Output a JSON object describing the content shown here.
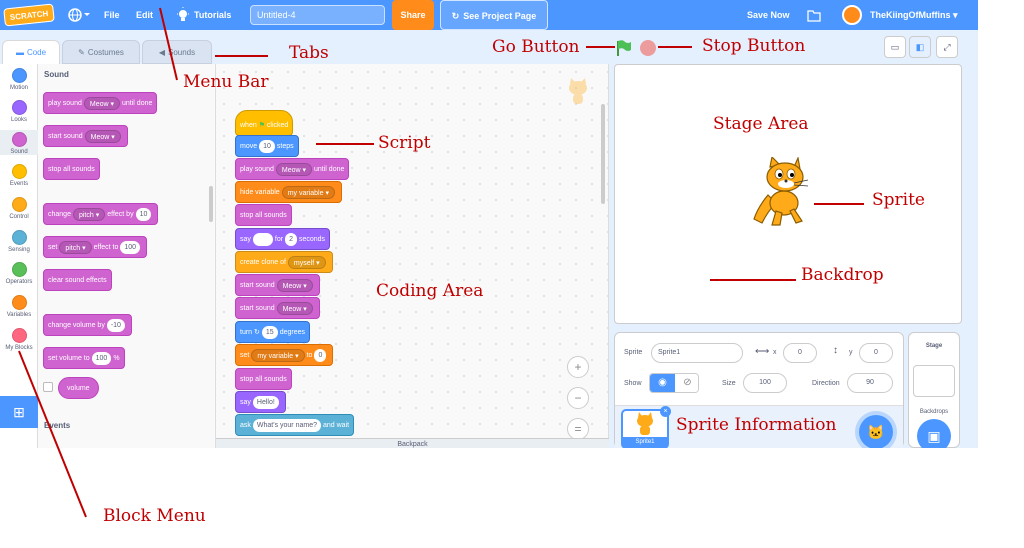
{
  "menubar": {
    "logo_text": "SCRATCH",
    "file_label": "File",
    "edit_label": "Edit",
    "tutorials_label": "Tutorials",
    "project_title": "Untitled-4",
    "share_label": "Share",
    "see_project_label": "See Project Page",
    "save_now_label": "Save Now",
    "username": "TheKiingOfMuffins"
  },
  "tabs": {
    "code": "Code",
    "costumes": "Costumes",
    "sounds": "Sounds"
  },
  "categories": [
    {
      "label": "Motion",
      "color": "#4c97ff"
    },
    {
      "label": "Looks",
      "color": "#9966ff"
    },
    {
      "label": "Sound",
      "color": "#cf63cf"
    },
    {
      "label": "Events",
      "color": "#ffbf00"
    },
    {
      "label": "Control",
      "color": "#ffab19"
    },
    {
      "label": "Sensing",
      "color": "#5cb1d6"
    },
    {
      "label": "Operators",
      "color": "#59c059"
    },
    {
      "label": "Variables",
      "color": "#ff8c1a"
    },
    {
      "label": "My Blocks",
      "color": "#ff6680"
    }
  ],
  "palette": {
    "section_sound": "Sound",
    "section_events": "Events",
    "play_sound_until_done": {
      "a": "play sound",
      "b": "Meow",
      "c": "until done"
    },
    "start_sound": {
      "a": "start sound",
      "b": "Meow"
    },
    "stop_all_sounds": "stop all sounds",
    "change_effect": {
      "a": "change",
      "b": "pitch",
      "c": "effect by",
      "d": "10"
    },
    "set_effect": {
      "a": "set",
      "b": "pitch",
      "c": "effect to",
      "d": "100"
    },
    "clear_effects": "clear sound effects",
    "change_volume": {
      "a": "change volume by",
      "b": "-10"
    },
    "set_volume": {
      "a": "set volume to",
      "b": "100",
      "c": "%"
    },
    "volume": "volume"
  },
  "script": {
    "when_flag": {
      "a": "when",
      "b": "clicked"
    },
    "move": {
      "a": "move",
      "b": "10",
      "c": "steps"
    },
    "play_sound": {
      "a": "play sound",
      "b": "Meow",
      "c": "until done"
    },
    "hide_variable": {
      "a": "hide variable",
      "b": "my variable"
    },
    "stop_all_sounds": "stop all sounds",
    "say_for": {
      "a": "say",
      "b": "for",
      "c": "2",
      "d": "seconds"
    },
    "create_clone": {
      "a": "create clone of",
      "b": "myself"
    },
    "start_sound_1": {
      "a": "start sound",
      "b": "Meow"
    },
    "start_sound_2": {
      "a": "start sound",
      "b": "Meow"
    },
    "turn": {
      "a": "turn",
      "b": "15",
      "c": "degrees"
    },
    "set_var": {
      "a": "set",
      "b": "my variable",
      "c": "to",
      "d": "0"
    },
    "stop_all_sounds_2": "stop all sounds",
    "say": {
      "a": "say",
      "b": "Hello!"
    },
    "ask": {
      "a": "ask",
      "b": "What's your name?",
      "c": "and wait"
    }
  },
  "backpack_label": "Backpack",
  "sprite_info": {
    "sprite_label": "Sprite",
    "sprite_name": "Sprite1",
    "x_label": "x",
    "x_value": "0",
    "y_label": "y",
    "y_value": "0",
    "show_label": "Show",
    "size_label": "Size",
    "size_value": "100",
    "direction_label": "Direction",
    "direction_value": "90",
    "thumb_label": "Sprite1"
  },
  "stage_panel": {
    "title": "Stage",
    "backdrops_label": "Backdrops"
  },
  "annotations": {
    "menu_bar": "Menu Bar",
    "tabs": "Tabs",
    "go_button": "Go Button",
    "stop_button": "Stop Button",
    "script": "Script",
    "stage_area": "Stage Area",
    "sprite": "Sprite",
    "backdrop": "Backdrop",
    "coding_area": "Coding Area",
    "sprite_information": "Sprite Information",
    "block_menu": "Block Menu"
  },
  "colors": {
    "menubar": "#4c97ff",
    "share": "#ff8c1a",
    "annotation": "#c00000",
    "go_flag": "#4cbf56",
    "stop": "#ec9c9c"
  }
}
